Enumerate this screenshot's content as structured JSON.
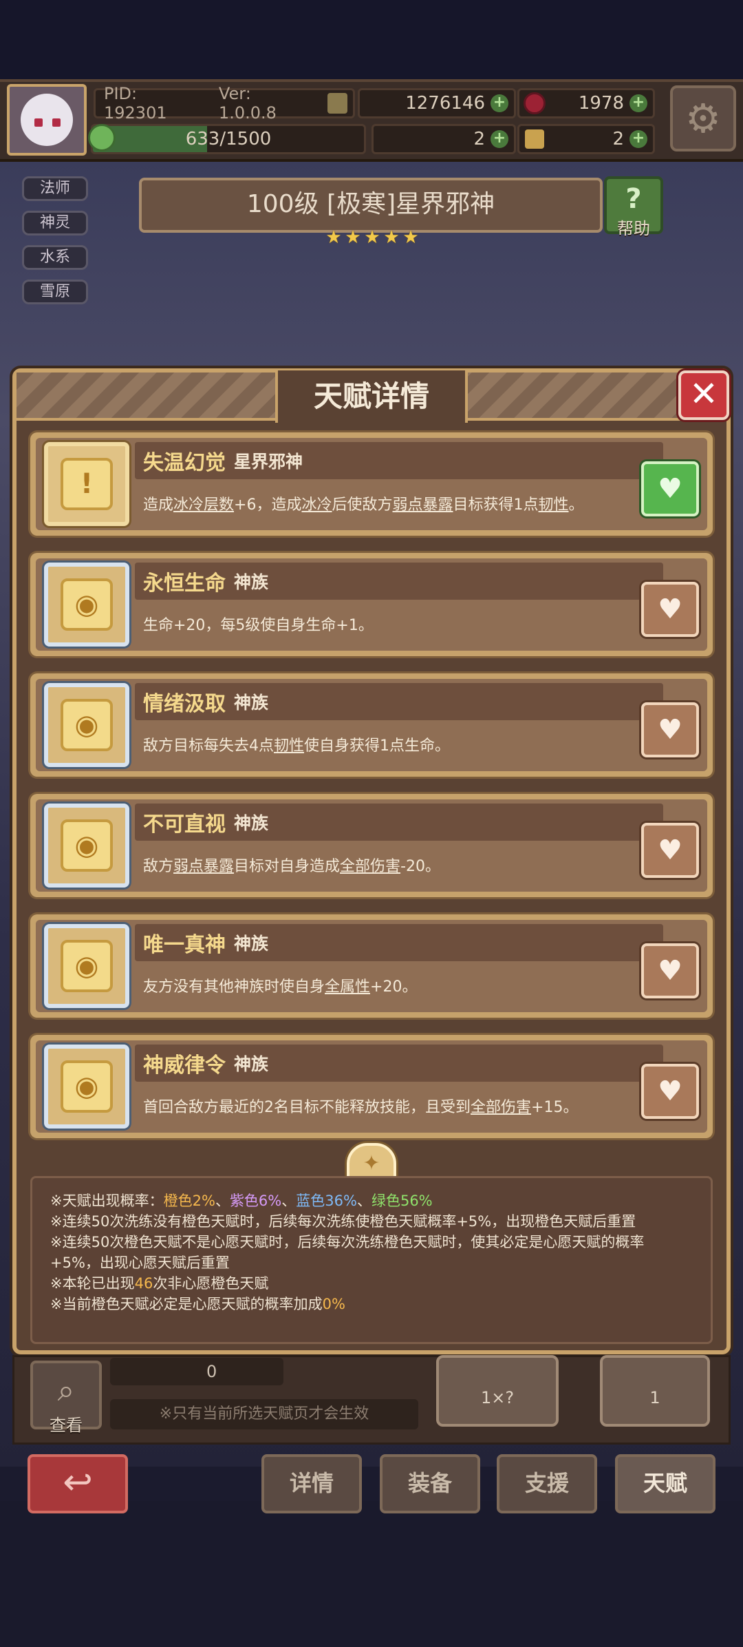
{
  "header": {
    "pid": "PID: 192301",
    "version": "Ver: 1.0.0.8",
    "gold": "1276146",
    "gems": "1978",
    "xp_text": "633/1500",
    "xp_fraction": 0.422,
    "clover_count": "2",
    "scroll_count": "2"
  },
  "tags": [
    "法师",
    "神灵",
    "水系",
    "雪原"
  ],
  "hero": {
    "title": "100级 [极寒]星界邪神",
    "stars": 5,
    "help_label": "帮助",
    "help_icon": "?"
  },
  "modal": {
    "title": "天赋详情",
    "close_icon": "✕",
    "talents": [
      {
        "name": "失温幻觉",
        "race": "星界邪神",
        "desc_parts": [
          "造成",
          "冰冷层数",
          "+6，造成",
          "冰冷",
          "后使敌方",
          "弱点暴露",
          "目标获得1点",
          "韧性",
          "。"
        ],
        "underline": [
          1,
          3,
          5,
          7
        ],
        "favorite": true,
        "icon_style": "gold"
      },
      {
        "name": "永恒生命",
        "race": "神族",
        "desc_parts": [
          "生命+20，每5级使自身生命+1。"
        ],
        "underline": [],
        "favorite": false,
        "icon_style": "blue"
      },
      {
        "name": "情绪汲取",
        "race": "神族",
        "desc_parts": [
          "敌方目标每失去4点",
          "韧性",
          "使自身获得1点生命。"
        ],
        "underline": [
          1
        ],
        "favorite": false,
        "icon_style": "blue"
      },
      {
        "name": "不可直视",
        "race": "神族",
        "desc_parts": [
          "敌方",
          "弱点暴露",
          "目标对自身造成",
          "全部伤害",
          "-20。"
        ],
        "underline": [
          1,
          3
        ],
        "favorite": false,
        "icon_style": "blue"
      },
      {
        "name": "唯一真神",
        "race": "神族",
        "desc_parts": [
          "友方没有其他神族时使自身",
          "全属性",
          "+20。"
        ],
        "underline": [
          1
        ],
        "favorite": false,
        "icon_style": "blue"
      },
      {
        "name": "神威律令",
        "race": "神族",
        "desc_parts": [
          "首回合敌方最近的2名目标不能释放技能，且受到",
          "全部伤害",
          "+15。"
        ],
        "underline": [
          1
        ],
        "favorite": false,
        "icon_style": "blue"
      }
    ],
    "rules": {
      "line1_prefix": "※天赋出现概率：",
      "rate_orange": "橙色2%",
      "sep1": "、",
      "rate_purple": "紫色6%",
      "sep2": "、",
      "rate_blue": "蓝色36%",
      "sep3": "、",
      "rate_green": "绿色56%",
      "line2": "※连续50次洗练没有橙色天赋时，后续每次洗练使橙色天赋概率+5%，出现橙色天赋后重置",
      "line3": "※连续50次橙色天赋不是心愿天赋时，后续每次洗练橙色天赋时，使其必定是心愿天赋的概率",
      "line4": "+5%，出现心愿天赋后重置",
      "line5_prefix": "※本轮已出现",
      "line5_value": "46",
      "line5_suffix": "次非心愿橙色天赋",
      "line6_prefix": "※当前橙色天赋必定是心愿天赋的概率加成",
      "line6_value": "0%"
    }
  },
  "lower": {
    "view_label": "查看",
    "count": "0",
    "hint": "※只有当前所选天赋页才会生效",
    "auto_wash_count": "1×?",
    "wash_count": "1"
  },
  "nav": {
    "details": "详情",
    "equipment": "装备",
    "support": "支援",
    "talent": "天赋"
  },
  "colors": {
    "accent_gold": "#c9a36a",
    "orange": "#f5b84d",
    "purple": "#d59af7",
    "blue": "#7fbaf7",
    "green": "#8fe26b"
  }
}
